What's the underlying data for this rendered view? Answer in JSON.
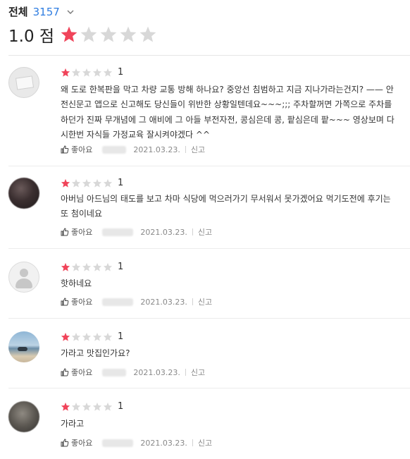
{
  "header": {
    "filter_label": "전체",
    "review_count": "3157",
    "average_score": "1.0 점",
    "average_rating": 1,
    "star_max": 5
  },
  "colors": {
    "accent_blue": "#2f7de1",
    "star_filled": "#f0445a",
    "star_empty": "#d8d8d8"
  },
  "reviews": [
    {
      "rating": 1,
      "rating_label": "1",
      "avatar_icon": "business-card-photo",
      "lines": [
        "왜 도로 한복판을 막고 차량 교통 방해 하나요? 중앙선 침범하고 지금 지나가라는건지? —— 안",
        "전신문고 앱으로 신고해도 당신들이 위반한 상황일텐데요~~~;;; 주차할꺼면 가쪽으로 주차를",
        "하던가 진짜 무개념에 그 애비에 그 아들 부전자전, 콩심은데 콩, 팥심은데 팥~~~ 영상보며 다",
        "시한번 자식들 가정교육 잘시켜야겠다 ^^"
      ],
      "like_label": "좋아요",
      "date": "2021.03.23.",
      "report_label": "신고"
    },
    {
      "rating": 1,
      "rating_label": "1",
      "avatar_icon": "blurred-photo",
      "lines": [
        "아버님 아드님의 태도를 보고 차마 식당에 먹으러가기 무서워서 못가겠어요 먹기도전에 후기는",
        "또 첨이네요"
      ],
      "like_label": "좋아요",
      "date": "2021.03.23.",
      "report_label": "신고"
    },
    {
      "rating": 1,
      "rating_label": "1",
      "avatar_icon": "default-user",
      "lines": [
        "핫하네요"
      ],
      "like_label": "좋아요",
      "date": "2021.03.23.",
      "report_label": "신고"
    },
    {
      "rating": 1,
      "rating_label": "1",
      "avatar_icon": "seaside-photo",
      "lines": [
        "가라고 맛집인가요?"
      ],
      "like_label": "좋아요",
      "date": "2021.03.23.",
      "report_label": "신고"
    },
    {
      "rating": 1,
      "rating_label": "1",
      "avatar_icon": "blurred-photo",
      "lines": [
        "가라고"
      ],
      "like_label": "좋아요",
      "date": "2021.03.23.",
      "report_label": "신고"
    }
  ]
}
